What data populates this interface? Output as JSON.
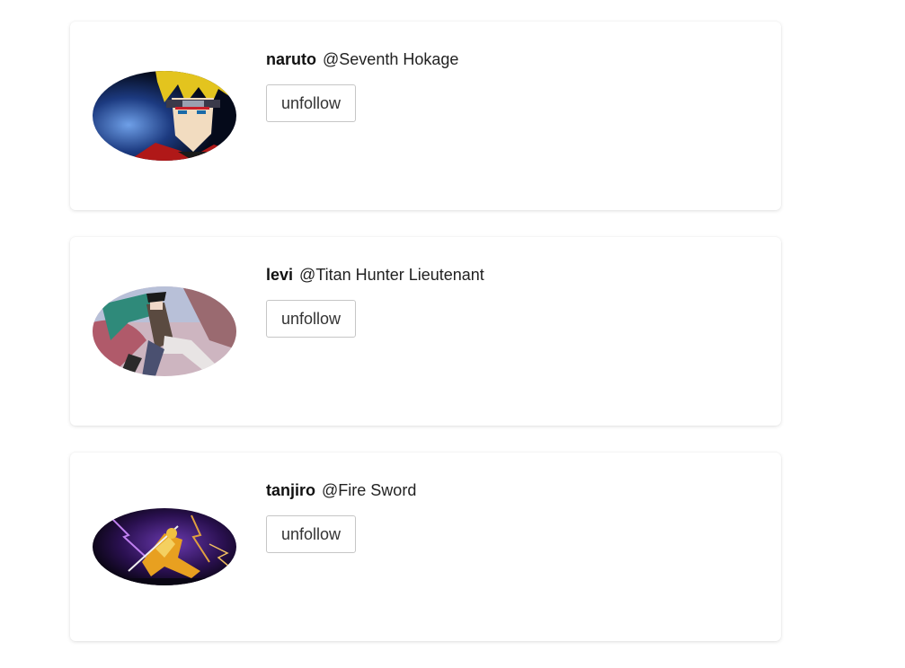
{
  "followed_users": [
    {
      "username": "naruto",
      "handle": "@Seventh Hokage",
      "button_label": "unfollow",
      "avatar_colors": [
        "#0a1430",
        "#2a5fb0",
        "#e8c020",
        "#c22a1a"
      ]
    },
    {
      "username": "levi",
      "handle": "@Titan Hunter Lieutenant",
      "button_label": "unfollow",
      "avatar_colors": [
        "#c9a0a8",
        "#2f8a7a",
        "#7a3a4a",
        "#4a5070"
      ]
    },
    {
      "username": "tanjiro",
      "handle": "@Fire Sword",
      "button_label": "unfollow",
      "avatar_colors": [
        "#0a0614",
        "#5a2a9a",
        "#e8a020",
        "#b060e0"
      ]
    }
  ]
}
